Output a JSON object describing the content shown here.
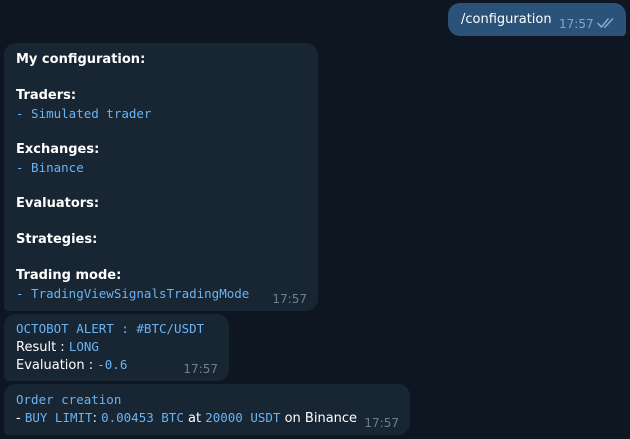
{
  "outgoing": {
    "text": "/configuration",
    "time": "17:57"
  },
  "config_message": {
    "title": "My configuration:",
    "traders_label": "Traders:",
    "traders_value": "- Simulated trader",
    "exchanges_label": "Exchanges:",
    "exchanges_value": "- Binance",
    "evaluators_label": "Evaluators:",
    "strategies_label": "Strategies:",
    "trading_mode_label": "Trading mode:",
    "trading_mode_value": "- TradingViewSignalsTradingMode",
    "time": "17:57"
  },
  "alert_message": {
    "header": "OCTOBOT ALERT : #BTC/USDT",
    "result_label": "Result : ",
    "result_value": "LONG",
    "evaluation_label": "Evaluation : ",
    "evaluation_value": "-0.6",
    "time": "17:57"
  },
  "order_message": {
    "header": "Order creation",
    "prefix": "- ",
    "side": "BUY LIMIT",
    "colon": ": ",
    "amount": "0.00453 BTC",
    "at": " at ",
    "price": "20000 USDT",
    "on": " on Binance",
    "time": "17:57"
  },
  "colors": {
    "background": "#0e1621",
    "incoming_bubble": "#182533",
    "outgoing_bubble": "#2b5278",
    "code_text": "#6ab3f3",
    "time_text": "#6d7f8f"
  }
}
